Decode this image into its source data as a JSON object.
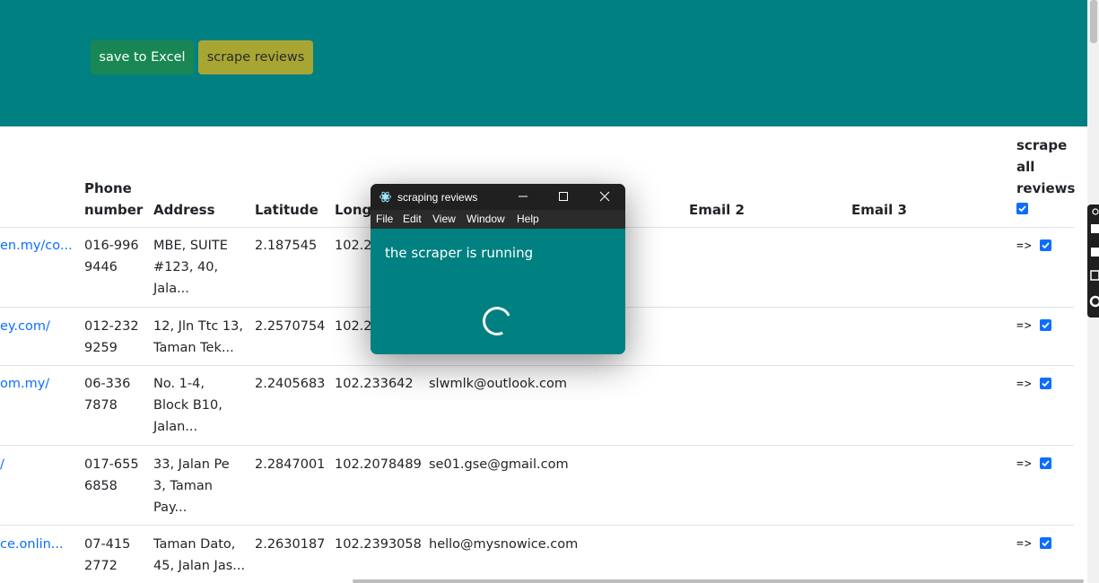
{
  "toolbar": {
    "save_label": "save to Excel",
    "scrape_label": "scrape reviews"
  },
  "table": {
    "headers": {
      "phone_line1": "Phone",
      "phone_line2": "number",
      "address": "Address",
      "latitude": "Latitude",
      "longitude": "Longi",
      "email2": "Email 2",
      "email3": "Email 3",
      "scrape_line1": "scrape",
      "scrape_line2": "all",
      "scrape_line3": "reviews"
    },
    "rows": [
      {
        "website": "en.my/co...",
        "phone1": "016-996",
        "phone2": "9446",
        "addr1": "MBE, SUITE",
        "addr2": "#123, 40,",
        "addr3": "Jala...",
        "lat": "2.187545",
        "lng": "102.25",
        "email": "",
        "arrow": "=>"
      },
      {
        "website": "ey.com/",
        "phone1": "012-232",
        "phone2": "9259",
        "addr1": "12, Jln Ttc 13,",
        "addr2": "Taman Tek...",
        "addr3": "",
        "lat": "2.2570754",
        "lng": "102.22",
        "email": "",
        "arrow": "=>"
      },
      {
        "website": "om.my/",
        "phone1": "06-336",
        "phone2": "7878",
        "addr1": "No. 1-4,",
        "addr2": "Block B10,",
        "addr3": "Jalan...",
        "lat": "2.2405683",
        "lng": "102.233642",
        "email": "slwmlk@outlook.com",
        "arrow": "=>"
      },
      {
        "website": "/",
        "phone1": "017-655",
        "phone2": "6858",
        "addr1": "33, Jalan Pe",
        "addr2": "3, Taman",
        "addr3": "Pay...",
        "lat": "2.2847001",
        "lng": "102.2078489",
        "email": "se01.gse@gmail.com",
        "arrow": "=>"
      },
      {
        "website": "ce.onlin...",
        "phone1": "07-415",
        "phone2": "2772",
        "addr1": "Taman Dato,",
        "addr2": "45, Jalan Jas...",
        "addr3": "",
        "lat": "2.2630187",
        "lng": "102.2393058",
        "email": "hello@mysnowice.com",
        "arrow": "=>"
      }
    ]
  },
  "popup": {
    "title": "scraping reviews",
    "menu": [
      "File",
      "Edit",
      "View",
      "Window",
      "Help"
    ],
    "message": "the scraper is running"
  },
  "icons": {
    "app": "electron-app-icon",
    "minimize": "minimize-icon",
    "maximize": "maximize-icon",
    "close": "close-icon",
    "spinner": "loading-spinner-icon",
    "checkbox": "checkbox-checked-icon"
  },
  "colors": {
    "header_bg": "#008080",
    "excel_btn": "#198754",
    "scrape_btn": "#a8a632",
    "link": "#0d6efd"
  }
}
